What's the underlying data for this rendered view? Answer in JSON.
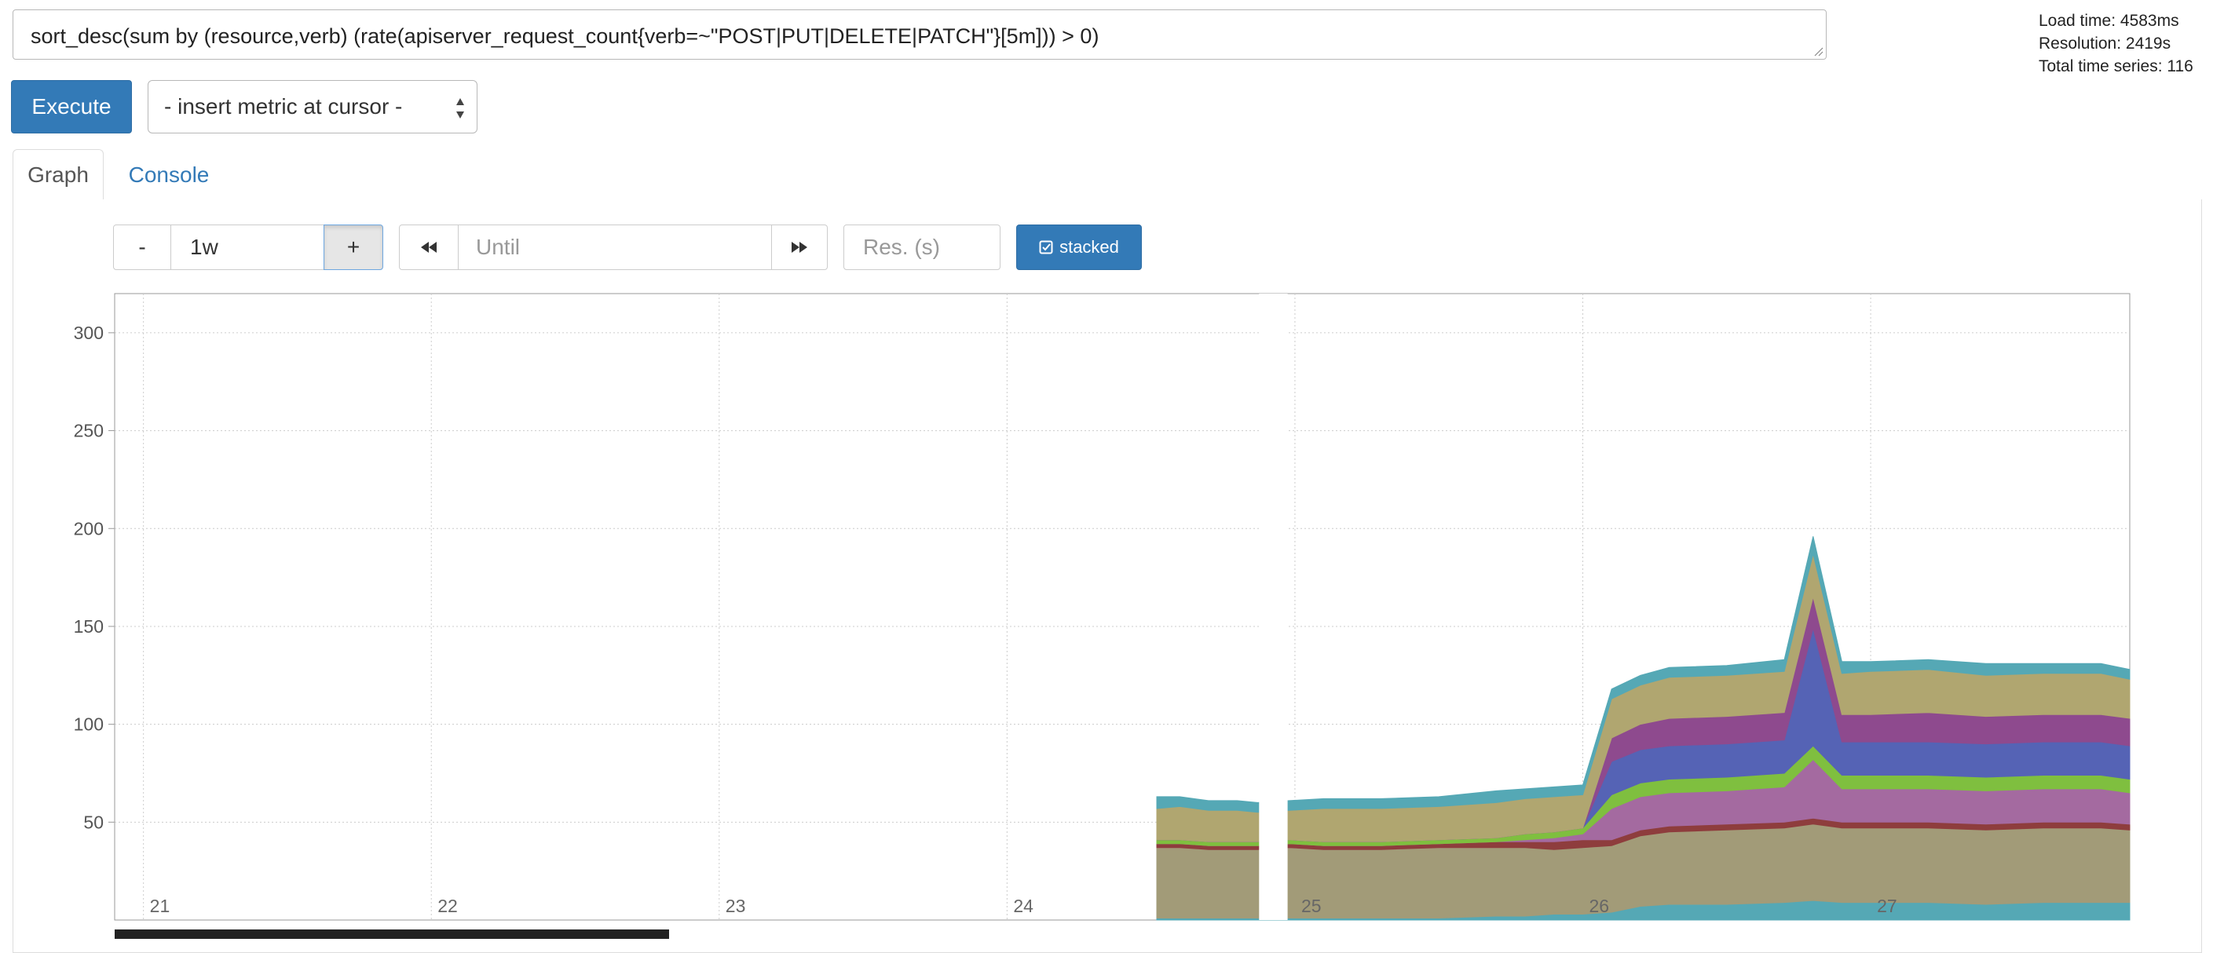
{
  "query": {
    "expression": "sort_desc(sum by (resource,verb) (rate(apiserver_request_count{verb=~\"POST|PUT|DELETE|PATCH\"}[5m])) > 0)"
  },
  "stats": {
    "load_time": "Load time: 4583ms",
    "resolution": "Resolution: 2419s",
    "total_series": "Total time series: 116"
  },
  "toolbar": {
    "execute_label": "Execute",
    "metric_select": "- insert metric at cursor -"
  },
  "tabs": [
    {
      "label": "Graph",
      "active": true
    },
    {
      "label": "Console",
      "active": false
    }
  ],
  "graph_controls": {
    "minus": "-",
    "range": "1w",
    "plus": "+",
    "until_placeholder": "Until",
    "res_placeholder": "Res. (s)",
    "stacked_label": "stacked"
  },
  "colors": {
    "primary": "#337ab7",
    "series": [
      "#55a8b5",
      "#a29b78",
      "#8e3d3d",
      "#a46aa0",
      "#7fbf3f",
      "#5563b5",
      "#8e4a8e",
      "#b0a670"
    ]
  },
  "chart_data": {
    "type": "area",
    "stacked": true,
    "title": "",
    "xlabel": "",
    "ylabel": "",
    "x_ticks": [
      "21",
      "22",
      "23",
      "24",
      "25",
      "26",
      "27"
    ],
    "y_ticks": [
      50,
      100,
      150,
      200,
      250,
      300
    ],
    "ylim": [
      0,
      320
    ],
    "xlim": [
      20.9,
      27.9
    ],
    "grid": true,
    "series": [
      {
        "x": [
          24.52,
          24.6,
          24.7,
          24.8,
          24.87,
          24.98,
          25.1,
          25.3,
          25.5,
          25.7,
          25.8,
          25.9,
          26.0,
          26.1,
          26.2,
          26.3,
          26.5,
          26.7,
          26.8,
          26.9,
          27.0,
          27.2,
          27.4,
          27.6,
          27.8,
          27.9
        ],
        "values": [
          1,
          1,
          1,
          1,
          1,
          1,
          1,
          1,
          1,
          2,
          2,
          3,
          3,
          4,
          7,
          8,
          8,
          9,
          10,
          9,
          9,
          9,
          8,
          9,
          9,
          9
        ]
      },
      {
        "x": [
          24.52,
          24.6,
          24.7,
          24.8,
          24.87,
          24.98,
          25.1,
          25.3,
          25.5,
          25.7,
          25.8,
          25.9,
          26.0,
          26.1,
          26.2,
          26.3,
          26.5,
          26.7,
          26.8,
          26.9,
          27.0,
          27.2,
          27.4,
          27.6,
          27.8,
          27.9
        ],
        "values": [
          36,
          36,
          35,
          35,
          35,
          36,
          35,
          35,
          36,
          35,
          35,
          33,
          34,
          34,
          36,
          37,
          38,
          38,
          39,
          38,
          38,
          38,
          38,
          38,
          38,
          37
        ]
      },
      {
        "x": [
          24.52,
          24.6,
          24.7,
          24.8,
          24.87,
          24.98,
          25.1,
          25.3,
          25.5,
          25.7,
          25.8,
          25.9,
          26.0,
          26.1,
          26.2,
          26.3,
          26.5,
          26.7,
          26.8,
          26.9,
          27.0,
          27.2,
          27.4,
          27.6,
          27.8,
          27.9
        ],
        "values": [
          2,
          2,
          2,
          2,
          2,
          2,
          2,
          2,
          2,
          3,
          3,
          4,
          4,
          3,
          3,
          3,
          3,
          3,
          3,
          3,
          3,
          3,
          3,
          3,
          3,
          3
        ]
      },
      {
        "x": [
          24.52,
          24.6,
          24.7,
          24.8,
          24.87,
          24.98,
          25.1,
          25.3,
          25.5,
          25.7,
          25.8,
          25.9,
          26.0,
          26.1,
          26.2,
          26.3,
          26.5,
          26.7,
          26.8,
          26.9,
          27.0,
          27.2,
          27.4,
          27.6,
          27.8,
          27.9
        ],
        "values": [
          0,
          0,
          0,
          0,
          0,
          0,
          0,
          0,
          0,
          0,
          1,
          2,
          3,
          16,
          17,
          17,
          17,
          18,
          30,
          17,
          17,
          17,
          17,
          17,
          17,
          16
        ]
      },
      {
        "x": [
          24.52,
          24.6,
          24.7,
          24.8,
          24.87,
          24.98,
          25.1,
          25.3,
          25.5,
          25.7,
          25.8,
          25.9,
          26.0,
          26.1,
          26.2,
          26.3,
          26.5,
          26.7,
          26.8,
          26.9,
          27.0,
          27.2,
          27.4,
          27.6,
          27.8,
          27.9
        ],
        "values": [
          2,
          2,
          2,
          2,
          2,
          2,
          2,
          2,
          2,
          2,
          3,
          3,
          3,
          7,
          7,
          7,
          7,
          7,
          7,
          7,
          7,
          7,
          7,
          7,
          7,
          7
        ]
      },
      {
        "x": [
          24.52,
          24.6,
          24.7,
          24.8,
          24.87,
          24.98,
          25.1,
          25.3,
          25.5,
          25.7,
          25.8,
          25.9,
          26.0,
          26.1,
          26.2,
          26.3,
          26.5,
          26.7,
          26.8,
          26.9,
          27.0,
          27.2,
          27.4,
          27.6,
          27.8,
          27.9
        ],
        "values": [
          0,
          0,
          0,
          0,
          0,
          0,
          0,
          0,
          0,
          0,
          0,
          0,
          0,
          17,
          17,
          17,
          17,
          17,
          60,
          17,
          17,
          17,
          17,
          17,
          17,
          17
        ]
      },
      {
        "x": [
          24.52,
          24.6,
          24.7,
          24.8,
          24.87,
          24.98,
          25.1,
          25.3,
          25.5,
          25.7,
          25.8,
          25.9,
          26.0,
          26.1,
          26.2,
          26.3,
          26.5,
          26.7,
          26.8,
          26.9,
          27.0,
          27.2,
          27.4,
          27.6,
          27.8,
          27.9
        ],
        "values": [
          0,
          0,
          0,
          0,
          0,
          0,
          0,
          0,
          0,
          0,
          0,
          0,
          0,
          12,
          13,
          14,
          14,
          14,
          16,
          14,
          14,
          15,
          14,
          14,
          14,
          14
        ]
      },
      {
        "x": [
          24.52,
          24.6,
          24.7,
          24.8,
          24.87,
          24.98,
          25.1,
          25.3,
          25.5,
          25.7,
          25.8,
          25.9,
          26.0,
          26.1,
          26.2,
          26.3,
          26.5,
          26.7,
          26.8,
          26.9,
          27.0,
          27.2,
          27.4,
          27.6,
          27.8,
          27.9
        ],
        "values": [
          16,
          17,
          16,
          16,
          15,
          15,
          17,
          17,
          17,
          18,
          18,
          18,
          17,
          20,
          20,
          21,
          21,
          21,
          22,
          21,
          22,
          22,
          21,
          21,
          21,
          20
        ]
      },
      {
        "x": [
          24.52,
          24.6,
          24.7,
          24.8,
          24.87,
          24.98,
          25.1,
          25.3,
          25.5,
          25.7,
          25.8,
          25.9,
          26.0,
          26.1,
          26.2,
          26.3,
          26.5,
          26.7,
          26.8,
          26.9,
          27.0,
          27.2,
          27.4,
          27.6,
          27.8,
          27.9
        ],
        "values": [
          6,
          5,
          5,
          5,
          5,
          5,
          5,
          5,
          5,
          6,
          5,
          5,
          5,
          5,
          5,
          5,
          5,
          6,
          9,
          6,
          5,
          5,
          6,
          5,
          5,
          5
        ]
      }
    ]
  }
}
